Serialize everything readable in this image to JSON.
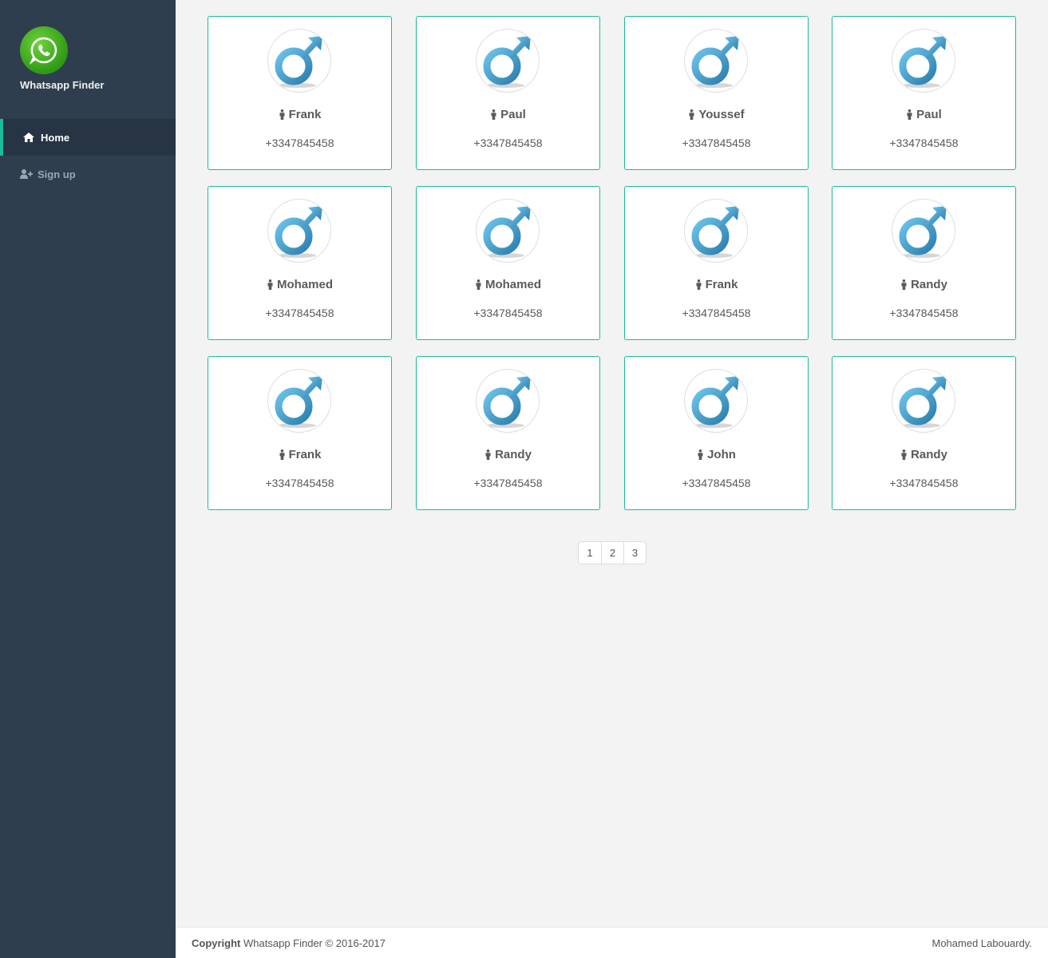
{
  "app": {
    "title": "Whatsapp Finder",
    "logo_icon": "whatsapp-icon",
    "brand_color": "#1abb9c"
  },
  "sidebar": {
    "items": [
      {
        "label": "Home",
        "icon": "home-icon",
        "active": true
      },
      {
        "label": "Sign up",
        "icon": "user-plus-icon",
        "active": false
      }
    ]
  },
  "contacts": [
    {
      "name": "Frank",
      "phone": "+3347845458",
      "icon": "male-symbol-icon"
    },
    {
      "name": "Paul",
      "phone": "+3347845458",
      "icon": "male-symbol-icon"
    },
    {
      "name": "Youssef",
      "phone": "+3347845458",
      "icon": "male-symbol-icon"
    },
    {
      "name": "Paul",
      "phone": "+3347845458",
      "icon": "male-symbol-icon"
    },
    {
      "name": "Mohamed",
      "phone": "+3347845458",
      "icon": "male-symbol-icon"
    },
    {
      "name": "Mohamed",
      "phone": "+3347845458",
      "icon": "male-symbol-icon"
    },
    {
      "name": "Frank",
      "phone": "+3347845458",
      "icon": "male-symbol-icon"
    },
    {
      "name": "Randy",
      "phone": "+3347845458",
      "icon": "male-symbol-icon"
    },
    {
      "name": "Frank",
      "phone": "+3347845458",
      "icon": "male-symbol-icon"
    },
    {
      "name": "Randy",
      "phone": "+3347845458",
      "icon": "male-symbol-icon"
    },
    {
      "name": "John",
      "phone": "+3347845458",
      "icon": "male-symbol-icon"
    },
    {
      "name": "Randy",
      "phone": "+3347845458",
      "icon": "male-symbol-icon"
    }
  ],
  "pagination": {
    "pages": [
      "1",
      "2",
      "3"
    ]
  },
  "footer": {
    "copyright_bold": "Copyright",
    "copyright_text": "Whatsapp Finder © 2016-2017",
    "author": "Mohamed Labouardy."
  }
}
